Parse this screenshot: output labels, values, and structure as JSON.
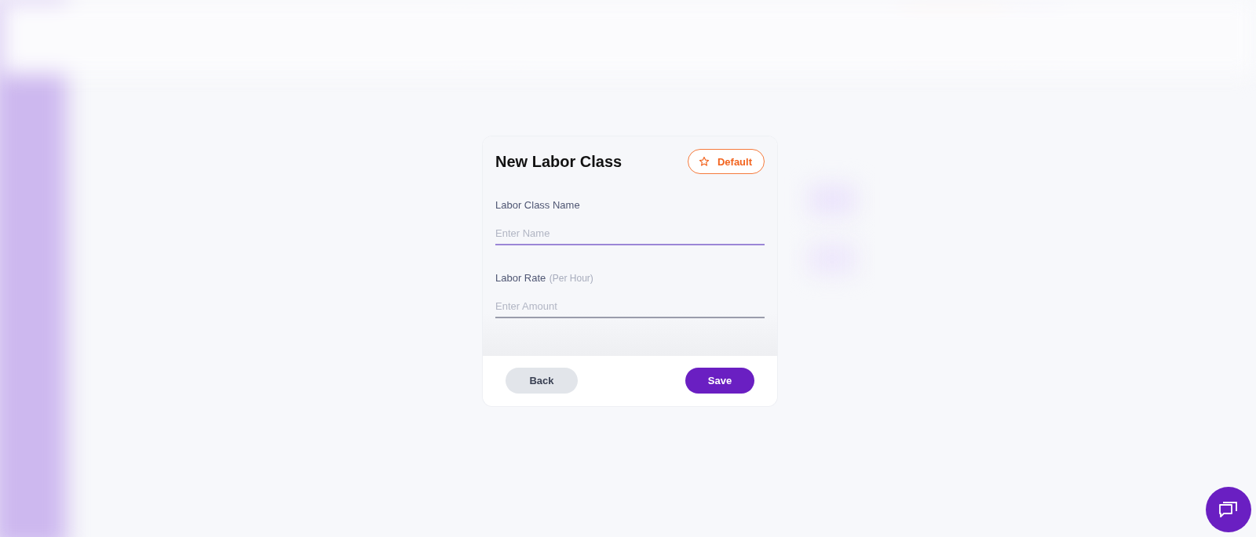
{
  "dialog": {
    "title": "New Labor Class",
    "default_button": {
      "label": "Default"
    },
    "fields": [
      {
        "label": "Labor Class Name",
        "placeholder": "Enter Name",
        "focused": true
      },
      {
        "label": "Labor Rate",
        "hint": "(Per Hour)",
        "placeholder": "Enter Amount",
        "focused": false
      }
    ],
    "buttons": [
      {
        "kind": "secondary",
        "label": "Back"
      },
      {
        "kind": "primary",
        "label": "Save"
      }
    ]
  }
}
